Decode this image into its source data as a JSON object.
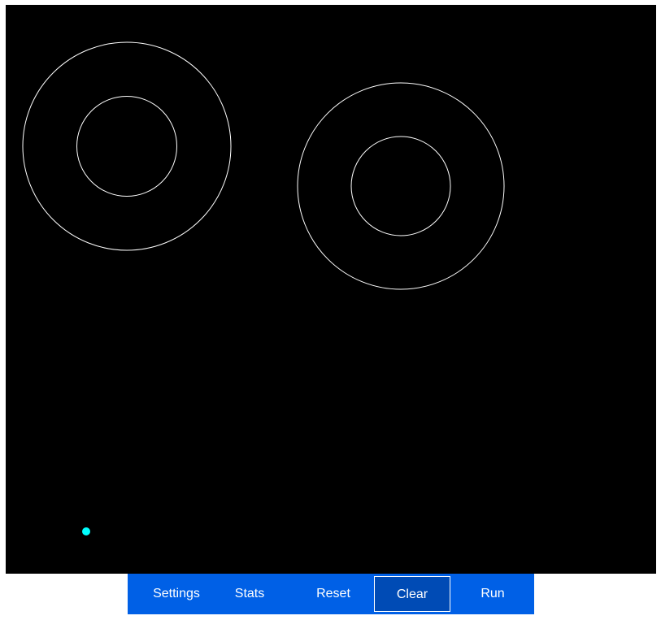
{
  "toolbar": {
    "buttons": [
      {
        "label": "Settings",
        "active": false
      },
      {
        "label": "Stats",
        "active": false
      },
      {
        "label": "Reset",
        "active": false
      },
      {
        "label": "Clear",
        "active": true
      },
      {
        "label": "Run",
        "active": false
      }
    ]
  },
  "canvas": {
    "background": "#000000",
    "ring_color": "#ffffff",
    "agent_color": "#00ffff"
  }
}
